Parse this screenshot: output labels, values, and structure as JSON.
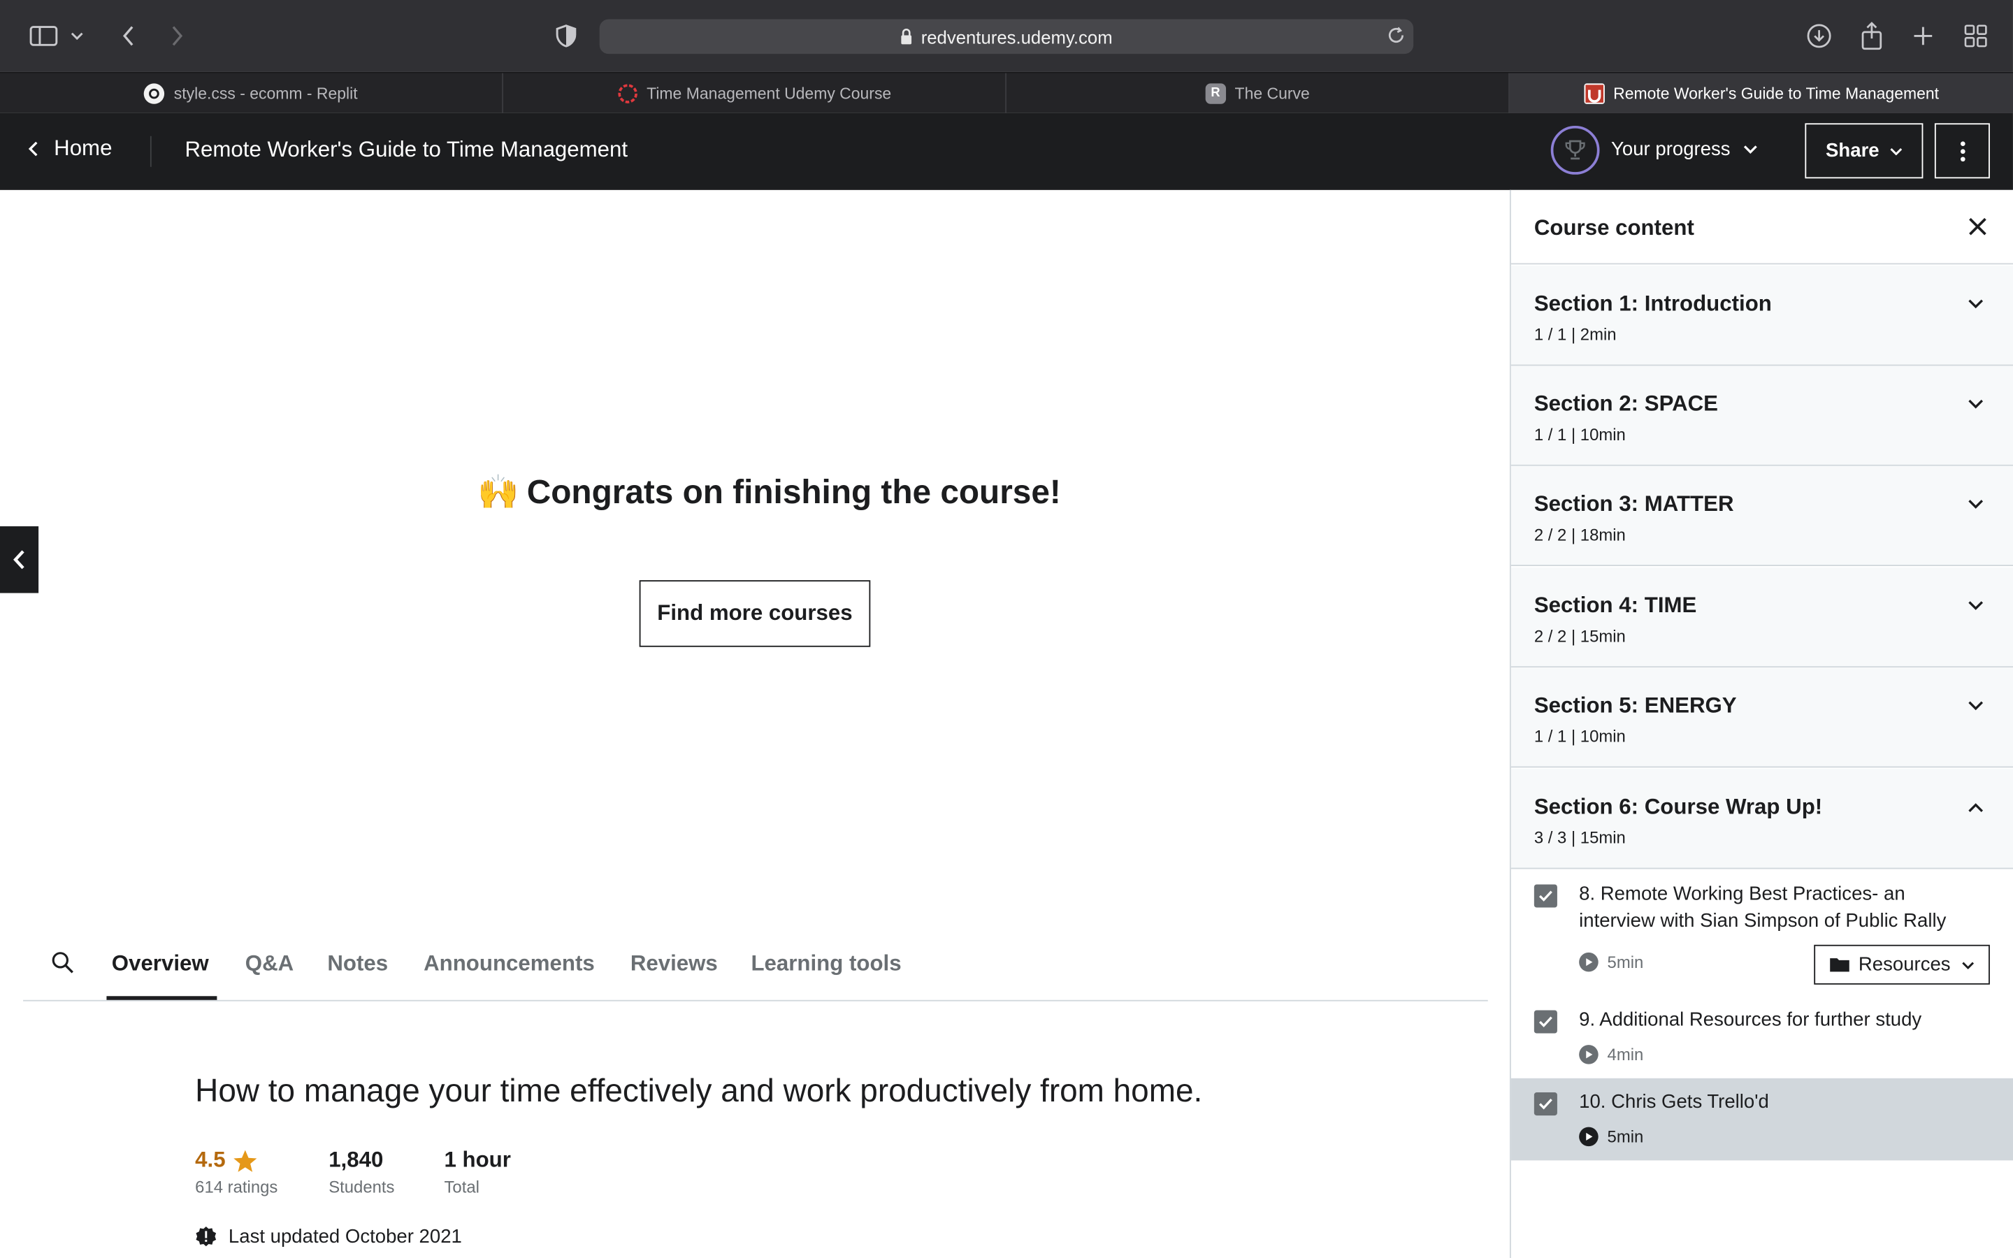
{
  "browser": {
    "url": "redventures.udemy.com",
    "tabs": [
      {
        "label": "style.css - ecomm - Replit",
        "icon": "replit-icon"
      },
      {
        "label": "Time Management Udemy Course",
        "icon": "udemy-course-icon"
      },
      {
        "label": "The Curve",
        "icon": "curve-icon",
        "favicon_letter": "R"
      },
      {
        "label": "Remote Worker's Guide to Time Management",
        "icon": "udemy-icon"
      }
    ]
  },
  "header": {
    "home_label": "Home",
    "course_title": "Remote Worker's Guide to Time Management",
    "progress_label": "Your progress",
    "share_label": "Share"
  },
  "main": {
    "congrats_emoji": "🙌",
    "congrats_text": "Congrats on finishing the course!",
    "find_courses_label": "Find more courses",
    "tabs": [
      "Overview",
      "Q&A",
      "Notes",
      "Announcements",
      "Reviews",
      "Learning tools"
    ],
    "active_tab": "Overview",
    "headline": "How to manage your time effectively and work productively from home.",
    "stats": {
      "rating": "4.5",
      "ratings_count": "614 ratings",
      "students_value": "1,840",
      "students_label": "Students",
      "total_value": "1 hour",
      "total_label": "Total"
    },
    "last_updated": "Last updated October 2021"
  },
  "sidebar": {
    "title": "Course content",
    "sections": [
      {
        "title": "Section 1: Introduction",
        "meta": "1 / 1 | 2min"
      },
      {
        "title": "Section 2: SPACE",
        "meta": "1 / 1 | 10min"
      },
      {
        "title": "Section 3: MATTER",
        "meta": "2 / 2 | 18min"
      },
      {
        "title": "Section 4: TIME",
        "meta": "2 / 2 | 15min"
      },
      {
        "title": "Section 5: ENERGY",
        "meta": "1 / 1 | 10min"
      },
      {
        "title": "Section 6: Course Wrap Up!",
        "meta": "3 / 3 | 15min"
      }
    ],
    "lectures": [
      {
        "title": "8. Remote Working Best Practices- an interview with Sian Simpson of Public Rally",
        "duration": "5min",
        "completed": true
      },
      {
        "title": "9. Additional Resources for further study",
        "duration": "4min",
        "completed": true
      },
      {
        "title": "10. Chris Gets Trello'd",
        "duration": "5min",
        "completed": true
      }
    ],
    "resources_label": "Resources"
  },
  "colors": {
    "accent_purple": "#8c7fd5",
    "rating_orange": "#b4690e",
    "header_bg": "#1c1d1f"
  }
}
